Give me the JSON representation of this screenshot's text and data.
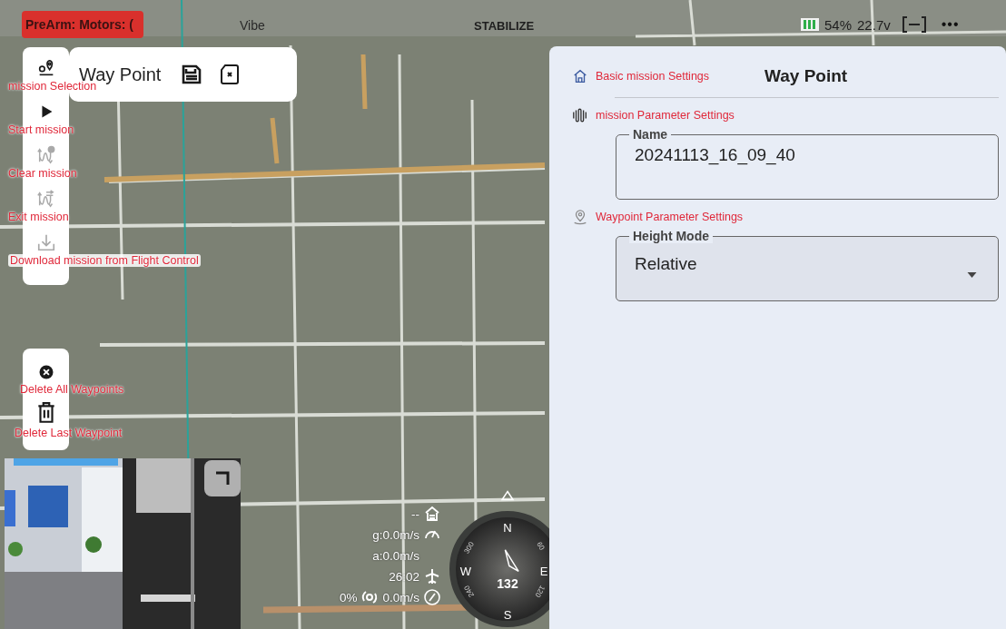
{
  "status": {
    "alert": "PreArm: Motors: (",
    "vibe": "Vibe",
    "mode": "STABILIZE",
    "battery": "54%",
    "voltage": "22.7v",
    "more": "•••"
  },
  "mission_card": {
    "title": "Way Point"
  },
  "toolbar": [
    {
      "label": "mission Selection",
      "kind": "select",
      "disabled": false
    },
    {
      "label": "Start mission",
      "kind": "play",
      "disabled": false
    },
    {
      "label": "Clear mission",
      "kind": "clear",
      "disabled": true
    },
    {
      "label": "Exit mission",
      "kind": "exit",
      "disabled": true
    },
    {
      "label": "Download mission  from Flight Control",
      "kind": "download",
      "disabled": true
    }
  ],
  "waypoint_tools": [
    {
      "label": "Delete All Waypoints",
      "kind": "delete_all"
    },
    {
      "label": "Delete Last Waypoint",
      "kind": "delete_last"
    }
  ],
  "telemetry": {
    "altitude": "--",
    "ground_speed": "g:0.0m/s",
    "air_speed": "a:0.0m/s",
    "flight_time": "26:02",
    "throttle": "0%",
    "vertical_speed": "0.0m/s"
  },
  "compass": {
    "heading": "132",
    "cardinals": [
      "N",
      "E",
      "S",
      "W"
    ],
    "ticks": [
      "300",
      "60",
      "240",
      "120"
    ]
  },
  "panel": {
    "title": "Way Point",
    "sections": [
      {
        "label": "Basic mission Settings",
        "kind": "home"
      },
      {
        "label": "mission Parameter Settings",
        "kind": "wave"
      },
      {
        "label": "Waypoint Parameter Settings",
        "kind": "location"
      }
    ],
    "fields": [
      {
        "label": "Name",
        "value": "20241113_16_09_40",
        "kind": "text"
      },
      {
        "label": "Height Mode",
        "value": "Relative",
        "kind": "select"
      }
    ]
  }
}
